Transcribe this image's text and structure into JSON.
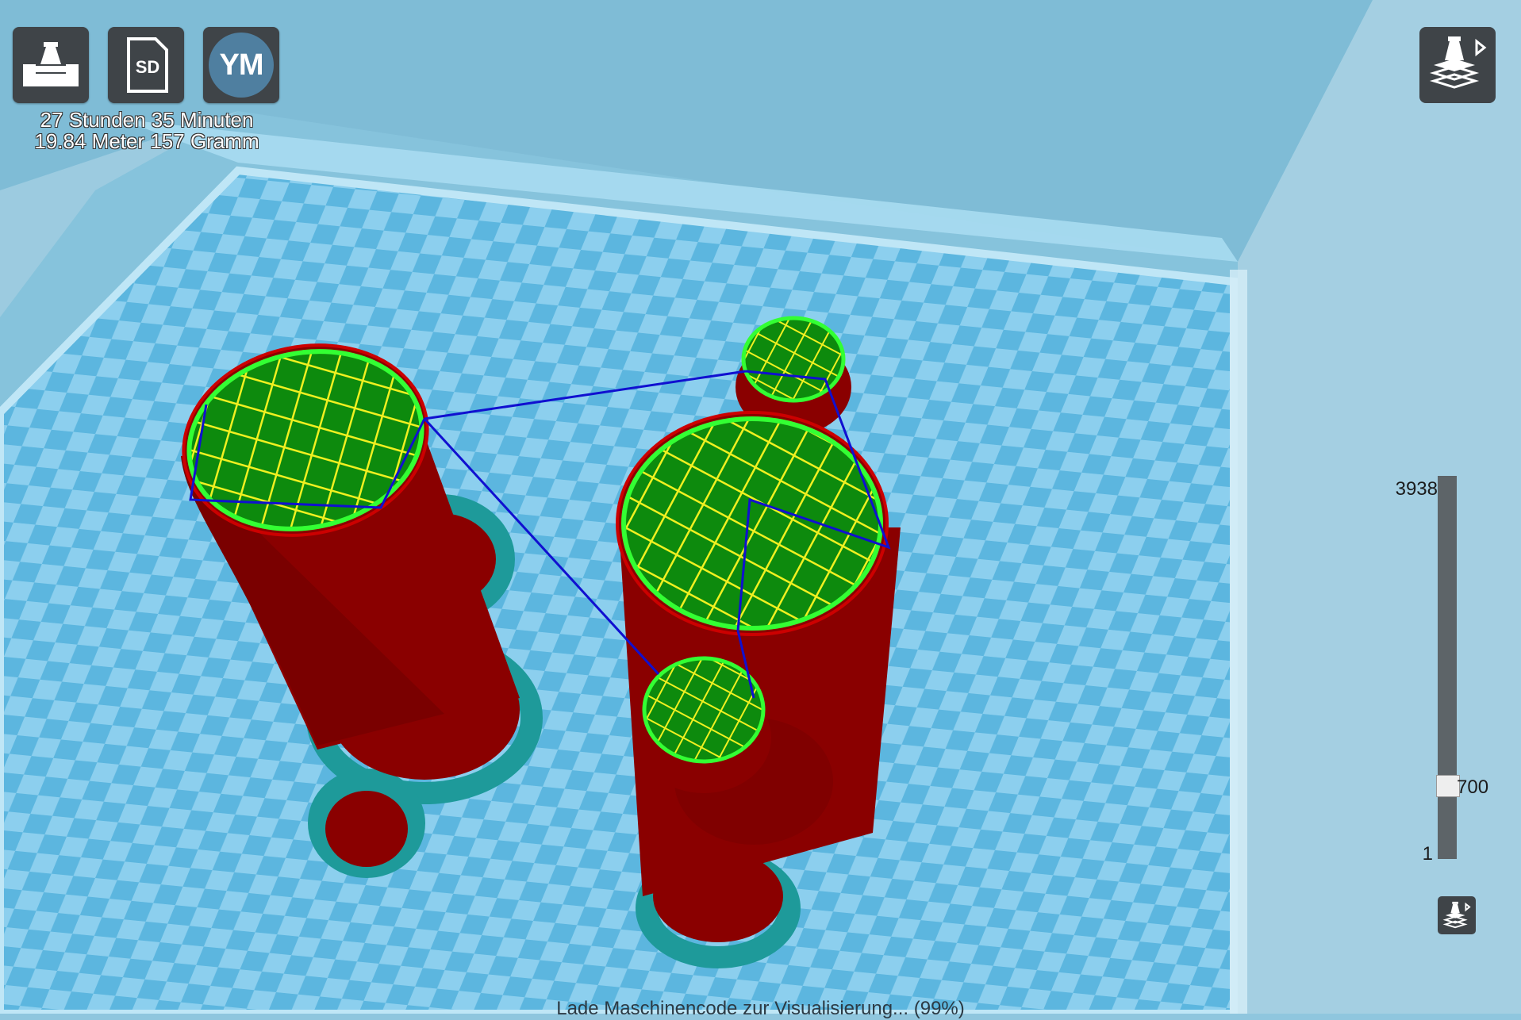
{
  "toolbar": {
    "print_icon": "printer-icon",
    "sd_label": "SD",
    "profile_initials": "YM"
  },
  "stats": {
    "duration": "27 Stunden 35 Minuten",
    "material": "19.84 Meter 157 Gramm"
  },
  "view_mode_icon": "layer-view-icon",
  "layer_slider": {
    "max": "3938",
    "current": "700",
    "min": "1",
    "position_fraction": 0.176
  },
  "status": "Lade Maschinencode zur Visualisierung... (99%)",
  "colors": {
    "wall": "#8a0000",
    "top_fill": "#0d8a0d",
    "infill_lines": "#f0f020",
    "outline": "#33ff33",
    "travel": "#1010d0",
    "skirt": "#1e9a9a",
    "bed_light": "#9fd8f0",
    "bed_dark": "#5eb8de"
  }
}
